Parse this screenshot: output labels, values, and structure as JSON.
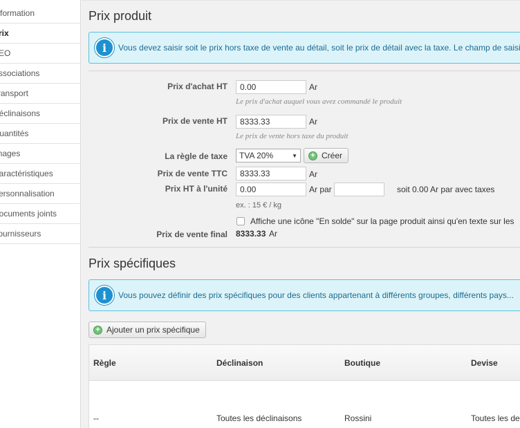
{
  "sidebar": {
    "items": [
      {
        "label": "Information",
        "active": false
      },
      {
        "label": "Prix",
        "active": true
      },
      {
        "label": "SEO",
        "active": false
      },
      {
        "label": "Associations",
        "active": false
      },
      {
        "label": "Transport",
        "active": false
      },
      {
        "label": "Déclinaisons",
        "active": false
      },
      {
        "label": "Quantités",
        "active": false
      },
      {
        "label": "Images",
        "active": false
      },
      {
        "label": "Caractéristiques",
        "active": false
      },
      {
        "label": "Personnalisation",
        "active": false
      },
      {
        "label": "Documents joints",
        "active": false
      },
      {
        "label": "Fournisseurs",
        "active": false
      }
    ]
  },
  "price_section": {
    "title": "Prix produit",
    "info": "Vous devez saisir soit le prix hors taxe de vente au détail, soit le prix de détail avec la taxe. Le champ de saisie",
    "wholesale_label": "Prix d'achat HT",
    "wholesale_value": "0.00",
    "wholesale_unit": "Ar",
    "wholesale_hint": "Le prix d'achat auquel vous avez commandé le produit",
    "retail_label": "Prix de vente HT",
    "retail_value": "8333.33",
    "retail_unit": "Ar",
    "retail_hint": "Le prix de vente hors taxe du produit",
    "tax_rule_label": "La règle de taxe",
    "tax_rule_value": "TVA 20%",
    "create_button": "Créer",
    "ttc_label": "Prix de vente TTC",
    "ttc_value": "8333.33",
    "ttc_unit": "Ar",
    "unit_price_label": "Prix HT à l'unité",
    "unit_price_value": "0.00",
    "unit_price_unit": "Ar par",
    "unit_text_value": "",
    "unit_price_taxed": "soit 0.00 Ar par avec taxes",
    "unit_example": "ex. : 15 € / kg",
    "on_sale_label": "Affiche une icône \"En solde\" sur la page produit ainsi qu'en texte sur les",
    "final_label": "Prix de vente final",
    "final_value": "8333.33",
    "final_unit": "Ar"
  },
  "specific_section": {
    "title": "Prix spécifiques",
    "info": "Vous pouvez définir des prix spécifiques pour des clients appartenant à différents groupes, différents pays...",
    "add_button": "Ajouter un prix spécifique",
    "table": {
      "headers": [
        "Règle",
        "Déclinaison",
        "Boutique",
        "Devise"
      ],
      "rows": [
        [
          "--",
          "Toutes les déclinaisons",
          "Rossini",
          "Toutes les devises"
        ]
      ]
    }
  },
  "colors": {
    "info_bg": "#dcf4f9",
    "info_border": "#5bc0de",
    "info_icon": "#1e91cf",
    "add_icon": "#72c279"
  }
}
